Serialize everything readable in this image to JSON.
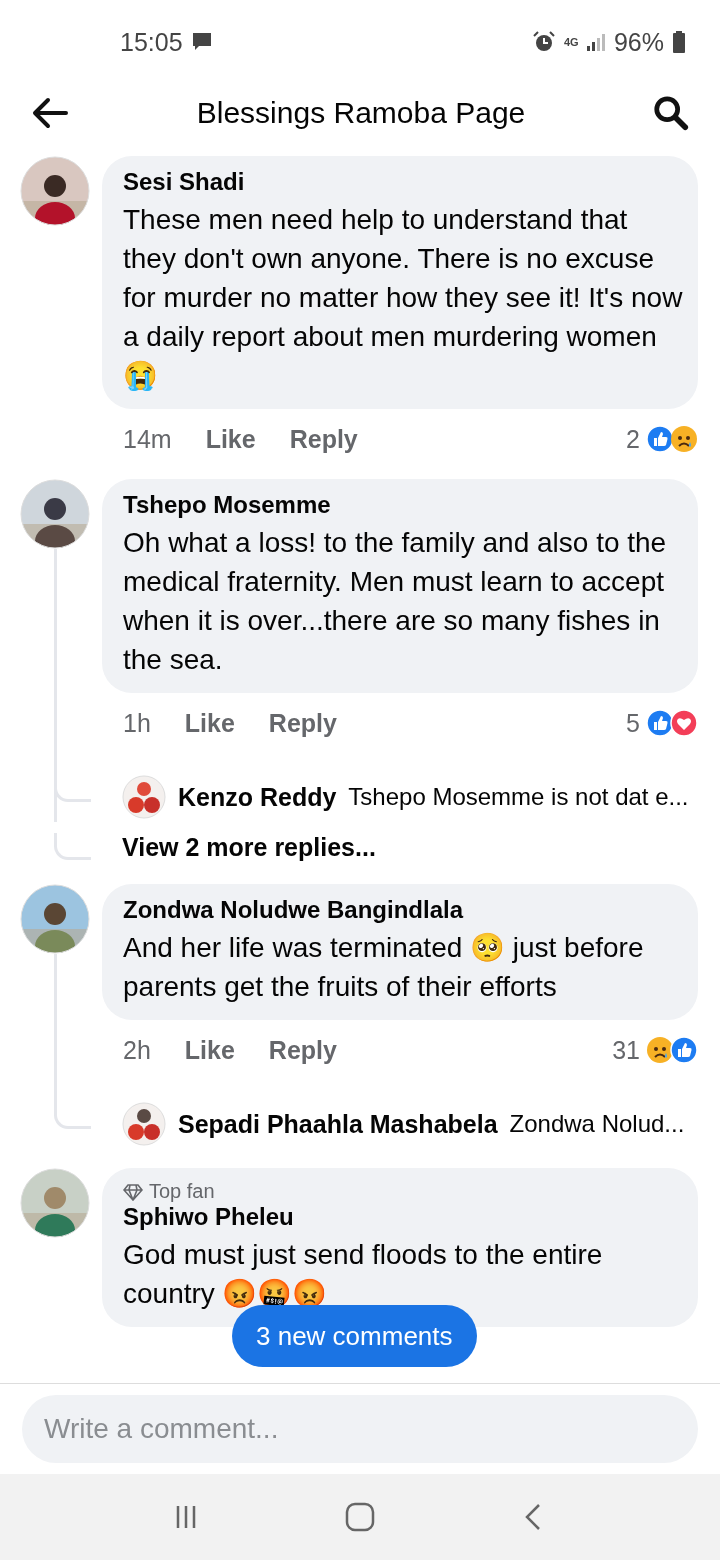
{
  "status_bar": {
    "time": "15:05",
    "network": "4G",
    "battery": "96%"
  },
  "header": {
    "title": "Blessings Ramoba Page"
  },
  "comments": [
    {
      "author": "Sesi Shadi",
      "body": "These men need help to understand that they don't own anyone. There is no excuse for murder no matter how they see it! It's now a daily report about men murdering women😭",
      "time": "14m",
      "like": "Like",
      "reply": "Reply",
      "reaction_count": "2",
      "reactions": [
        {
          "kind": "like"
        },
        {
          "kind": "sad"
        }
      ]
    },
    {
      "author": "Tshepo Mosemme",
      "body": "Oh what a loss! to the family and  also to the medical fraternity. Men must learn to accept when it is over...there are so many fishes in the sea.",
      "time": "1h",
      "like": "Like",
      "reply": "Reply",
      "reaction_count": "5",
      "reactions": [
        {
          "kind": "like"
        },
        {
          "kind": "love"
        }
      ],
      "replies": [
        {
          "author": "Kenzo Reddy",
          "preview": "Tshepo Mosemme is not dat e..."
        }
      ],
      "more_replies": "View 2 more replies..."
    },
    {
      "author": "Zondwa Noludwe Bangindlala",
      "body": "And her life was terminated 🥺 just before parents get the fruits of their efforts",
      "time": "2h",
      "like": "Like",
      "reply": "Reply",
      "reaction_count": "31",
      "reactions": [
        {
          "kind": "sad"
        },
        {
          "kind": "like"
        }
      ],
      "replies": [
        {
          "author": "Sepadi Phaahla Mashabela",
          "preview": "Zondwa Nolud..."
        }
      ]
    },
    {
      "badge": "Top fan",
      "author": "Sphiwo Pheleu",
      "body": "God must just send floods to the entire country 😡🤬😡"
    }
  ],
  "new_comments_button": "3 new comments",
  "composer": {
    "placeholder": "Write a comment..."
  }
}
